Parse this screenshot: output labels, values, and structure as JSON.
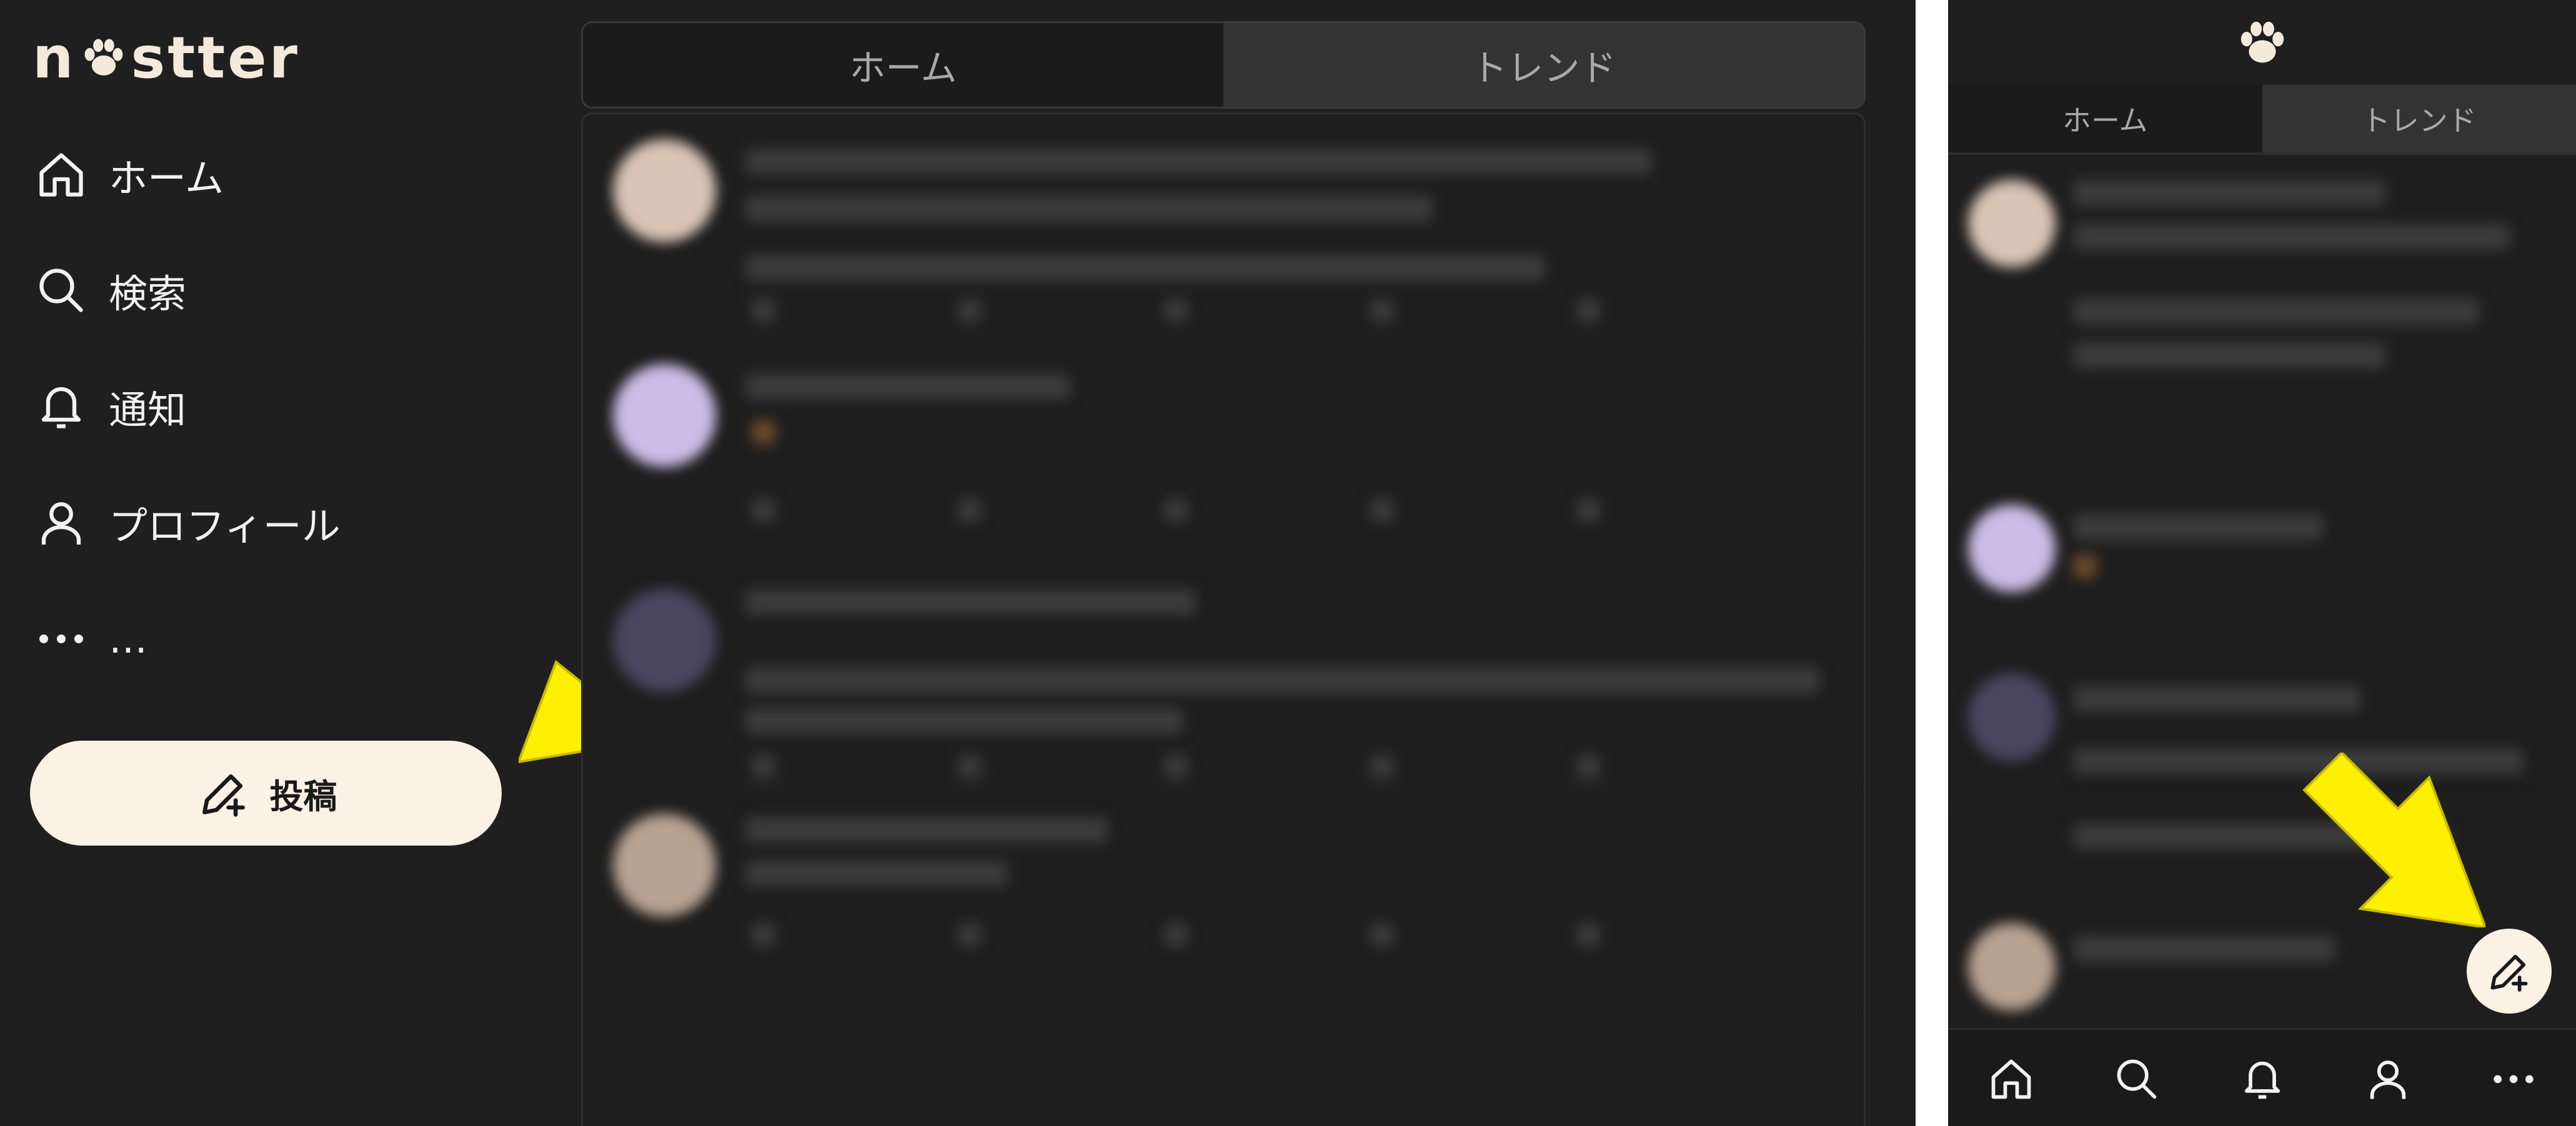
{
  "desktop": {
    "logo": {
      "text_left": "n",
      "text_right": "stter"
    },
    "nav": [
      {
        "label": "ホーム",
        "icon": "home-icon"
      },
      {
        "label": "検索",
        "icon": "search-icon"
      },
      {
        "label": "通知",
        "icon": "bell-icon"
      },
      {
        "label": "プロフィール",
        "icon": "user-icon"
      },
      {
        "label": "…",
        "icon": "more-icon"
      }
    ],
    "post_button": {
      "label": "投稿",
      "icon": "compose-icon"
    },
    "tabs": [
      {
        "label": "ホーム",
        "active": true
      },
      {
        "label": "トレンド",
        "active": false
      }
    ]
  },
  "mobile": {
    "header_icon": "paw-icon",
    "tabs": [
      {
        "label": "ホーム",
        "active": true
      },
      {
        "label": "トレンド",
        "active": false
      }
    ],
    "fab_icon": "compose-icon",
    "bottom_nav": [
      "home-icon",
      "search-icon",
      "bell-icon",
      "user-icon",
      "more-icon"
    ]
  },
  "colors": {
    "background": "#1f1f1f",
    "text": "#f2f2f2",
    "button_bg": "#fbf1e4",
    "arrow": "#ffff00"
  }
}
